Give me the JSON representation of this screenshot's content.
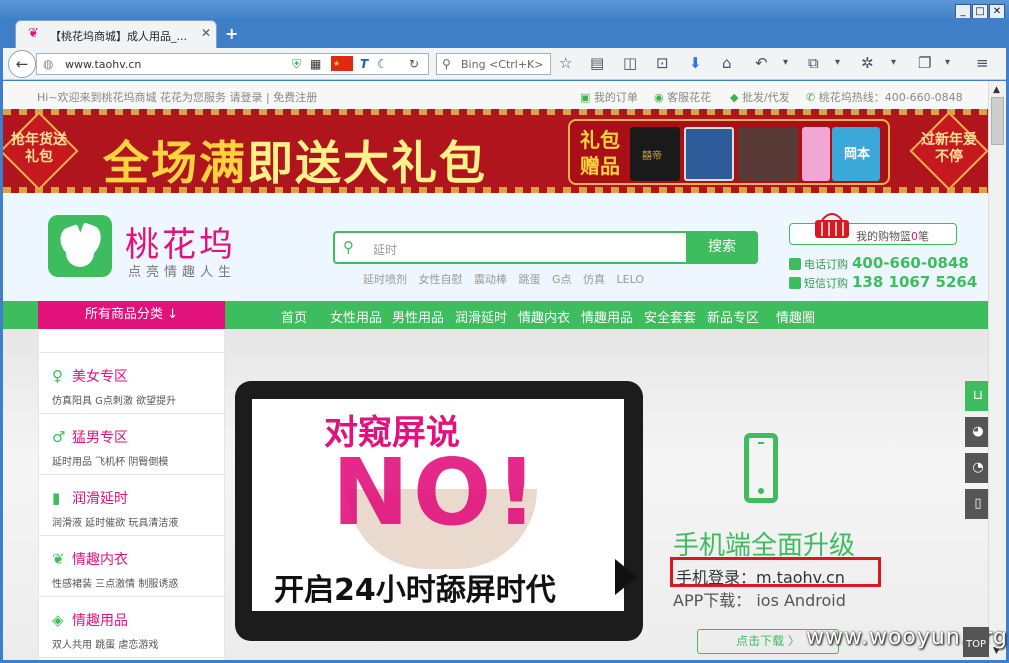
{
  "browser": {
    "tab_title": "【桃花坞商城】成人用品_...",
    "url": "www.taohv.cn",
    "search_placeholder": "Bing <Ctrl+K>",
    "window_controls": [
      "minimize",
      "maximize",
      "close"
    ]
  },
  "topbar": {
    "welcome": "Hi~欢迎来到桃花坞商城 花花为您服务 请登录 | 免费注册",
    "links": [
      "我的订单",
      "客服花花",
      "批发/代发",
      "桃花坞热线：400-660-0848"
    ]
  },
  "banner": {
    "left_badge": "抢年货送礼包",
    "slogan_a": "全场满",
    "slogan_b": "即送大礼包",
    "gift_label": "礼包赠品",
    "right_badge": "过新年爱不停",
    "product_labels": [
      "囍帝",
      "岡本"
    ]
  },
  "header": {
    "logo_name": "桃花坞",
    "logo_sub": "点亮情趣人生",
    "search_value": "延时",
    "search_button": "搜索",
    "hotwords": [
      "延时喷剂",
      "女性自慰",
      "震动棒",
      "跳蛋",
      "G点",
      "仿真",
      "LELO"
    ],
    "cart_text": "我的购物篮",
    "cart_count": "0",
    "cart_unit": "笔",
    "phone_label": "电话订购",
    "phone_number": "400-660-0848",
    "sms_label": "短信订购",
    "sms_number": "138 1067 5264"
  },
  "nav": {
    "all_categories": "所有商品分类 ↓",
    "links": [
      "首页",
      "女性用品",
      "男性用品",
      "润滑延时",
      "情趣内衣",
      "情趣用品",
      "安全套套",
      "新品专区",
      "情趣圈"
    ]
  },
  "categories": [
    {
      "name": "美女专区",
      "sub": "仿真阳具 G点刺激 欲望提升",
      "icon": "woman-icon"
    },
    {
      "name": "猛男专区",
      "sub": "延时用品 飞机杯 阴臀倒模",
      "icon": "man-icon"
    },
    {
      "name": "润滑延时",
      "sub": "润滑液 延时催欲 玩具清洁液",
      "icon": "bottle-icon"
    },
    {
      "name": "情趣内衣",
      "sub": "性感裙装 三点激情 制服诱惑",
      "icon": "lingerie-icon"
    },
    {
      "name": "情趣用品",
      "sub": "双人共用 跳蛋 虐恋游戏",
      "icon": "mask-icon"
    }
  ],
  "hero": {
    "headline": "对窥屏说",
    "big": "NO!",
    "tagline": "开启24小时舔屏时代",
    "upgrade": "手机端全面升级",
    "mobile_login": "手机登录：m.taohv.cn",
    "app_download": "APP下载：  ios    Android",
    "download_button": "点击下载 〉"
  },
  "top_button": "TOP",
  "watermark": "www.wooyun.org",
  "colors": {
    "brand_green": "#3dbd5d",
    "brand_pink": "#e2127d",
    "banner_red": "#b0141c",
    "highlight_red": "#d9181f"
  }
}
